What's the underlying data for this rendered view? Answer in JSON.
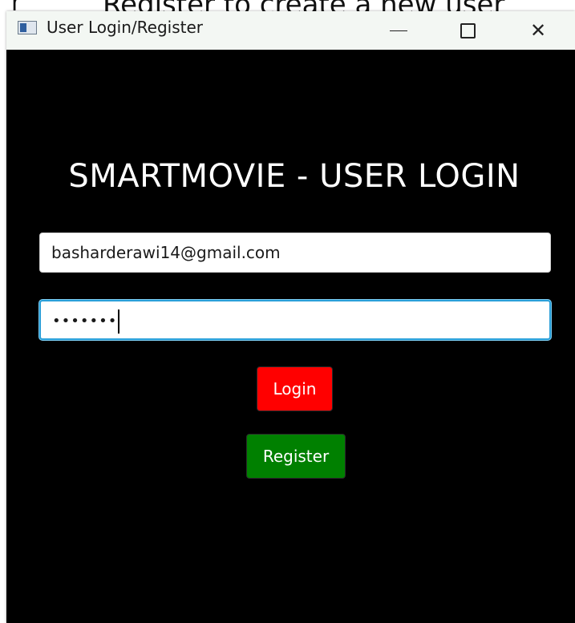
{
  "background_caption": {
    "lead": "r",
    "text": "Register to create a new user"
  },
  "window": {
    "title": "User Login/Register",
    "icon": "app-window-icon",
    "controls": {
      "minimize_icon": "minimize-icon",
      "maximize_icon": "maximize-icon",
      "close_icon": "close-icon",
      "close_glyph": "✕"
    }
  },
  "login_form": {
    "heading": "SMARTMOVIE - USER LOGIN",
    "email_value": "basharderawi14@gmail.com",
    "password_masked": "•••••••",
    "login_label": "Login",
    "register_label": "Register"
  },
  "colors": {
    "background": "#000000",
    "login_button": "#ff0000",
    "register_button": "#008000",
    "focus_border": "#2a9fd8"
  }
}
